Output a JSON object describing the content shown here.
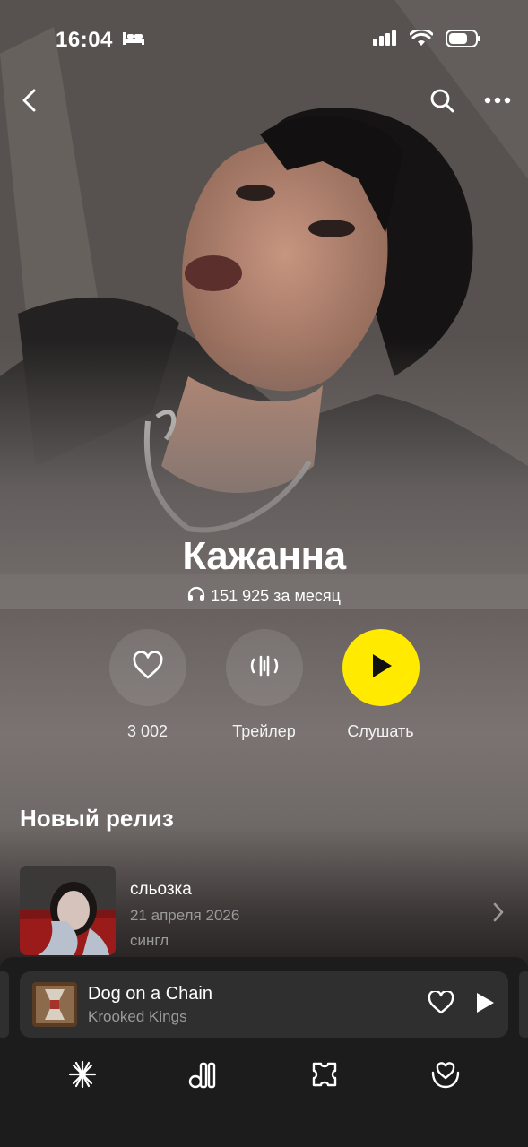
{
  "status_bar": {
    "time": "16:04",
    "icons": [
      "bed-icon",
      "signal-icon",
      "wifi-icon",
      "battery-icon"
    ]
  },
  "top_nav": {
    "icons": [
      "back-icon",
      "search-icon",
      "more-icon"
    ]
  },
  "artist": {
    "name": "Кажанна",
    "monthly_listeners": "151 925 за месяц"
  },
  "actions": {
    "like_count": "3 002",
    "trailer_label": "Трейлер",
    "listen_label": "Слушать"
  },
  "new_release": {
    "section_title": "Новый релиз",
    "title": "сльозка",
    "date": "21 апреля 2026",
    "type": "сингл"
  },
  "mini_player": {
    "title": "Dog on a Chain",
    "artist": "Krooked Kings"
  },
  "tab_bar": {
    "items": [
      "wave-icon",
      "collection-icon",
      "podcasts-icon",
      "favorites-icon"
    ]
  },
  "colors": {
    "accent": "#ffea00",
    "secondary_text": "#9a9a9a",
    "player_bg": "#2f2f2f"
  }
}
